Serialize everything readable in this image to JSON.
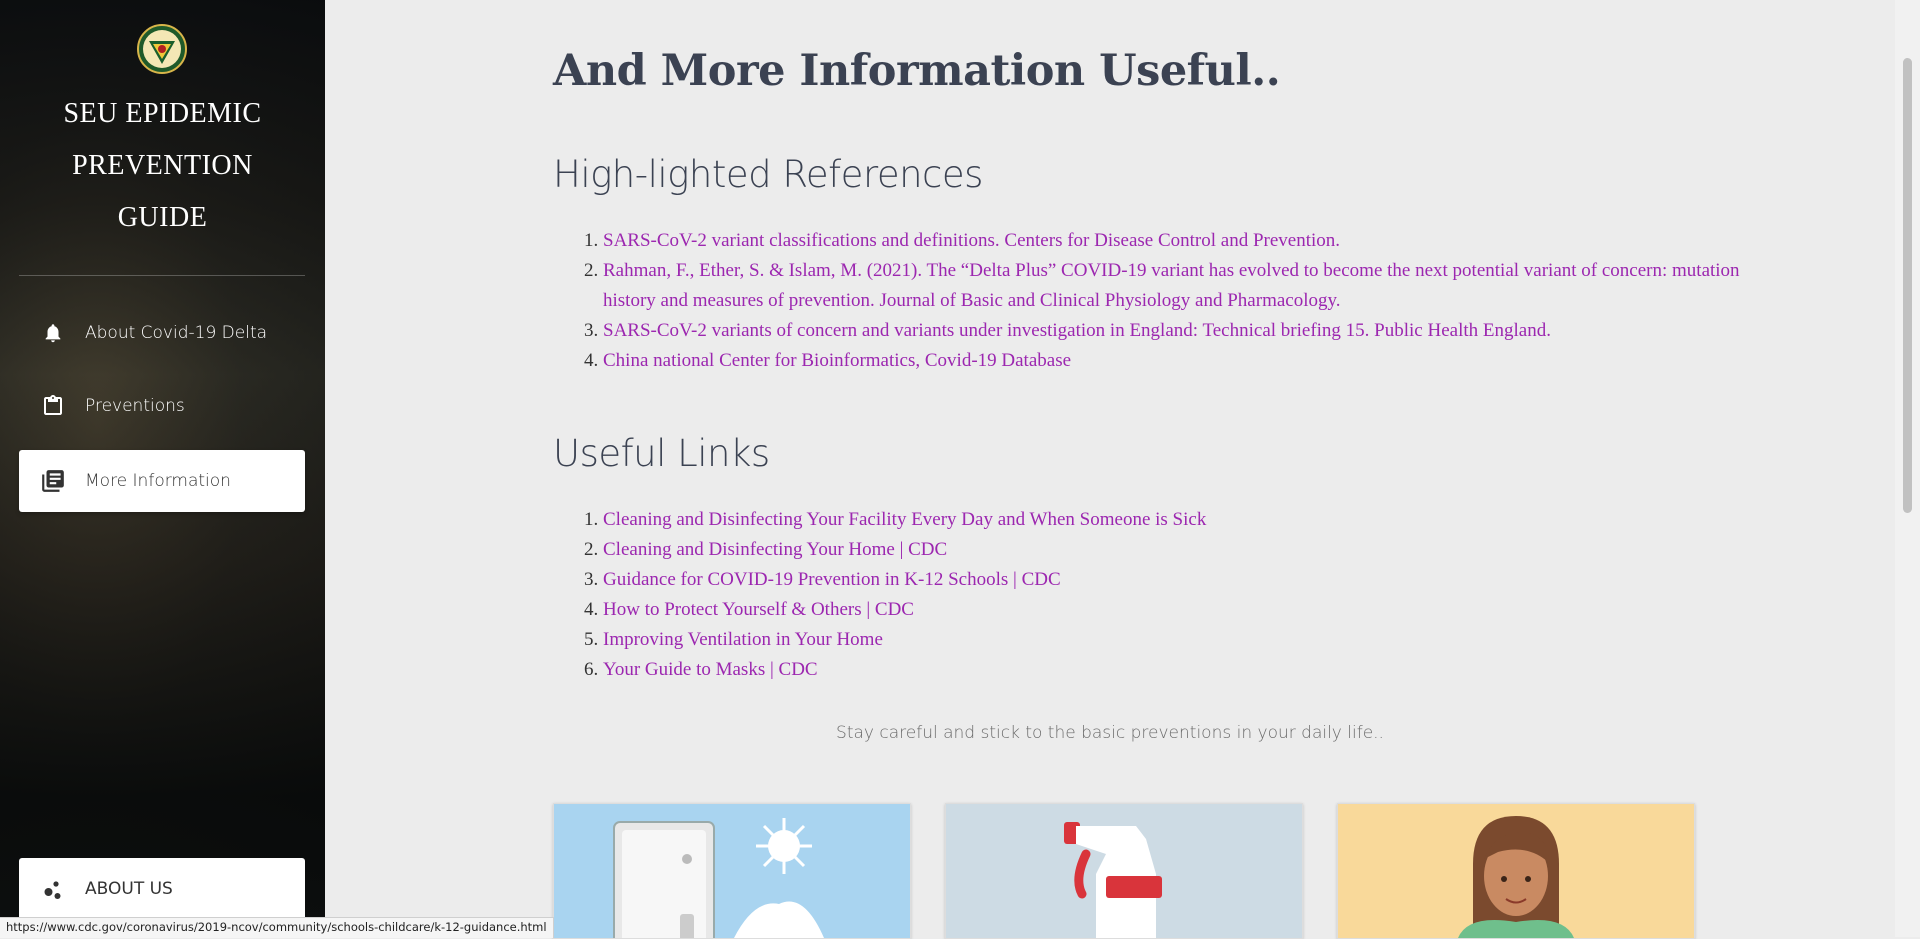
{
  "sidebar": {
    "title_line1": "SEU EPIDEMIC",
    "title_line2": "PREVENTION",
    "title_line3": "GUIDE",
    "nav": [
      {
        "label": "About Covid-19 Delta",
        "icon": "bell-icon"
      },
      {
        "label": "Preventions",
        "icon": "clipboard-icon"
      },
      {
        "label": "More Information",
        "icon": "library-books-icon",
        "active": true
      }
    ],
    "about_label": "ABOUT US"
  },
  "main": {
    "heading": "And More Information Useful..",
    "references_heading": "High-lighted References",
    "references": [
      "SARS-CoV-2 variant classifications and definitions. Centers for Disease Control and Prevention.",
      "Rahman, F., Ether, S. & Islam, M. (2021). The “Delta Plus” COVID-19 variant has evolved to become the next potential variant of concern: mutation history and measures of prevention. Journal of Basic and Clinical Physiology and Pharmacology.",
      "SARS-CoV-2 variants of concern and variants under investigation in England: Technical briefing 15. Public Health England.",
      "China national Center for Bioinformatics, Covid-19 Database"
    ],
    "links_heading": "Useful Links",
    "links": [
      "Cleaning and Disinfecting Your Facility Every Day and When Someone is Sick",
      "Cleaning and Disinfecting Your Home | CDC",
      "Guidance for COVID-19 Prevention in K-12 Schools | CDC",
      "How to Protect Yourself & Others | CDC",
      "Improving Ventilation in Your Home",
      "Your Guide to Masks | CDC"
    ],
    "tagline": "Stay careful and stick to the basic preventions in your daily life..",
    "cards": [
      {
        "icon": "light-switch-illustration",
        "bg": "#a9d4f0"
      },
      {
        "icon": "spray-bottle-illustration",
        "bg": "#cddbe4"
      },
      {
        "icon": "woman-avatar-illustration",
        "bg": "#f9d99a"
      }
    ]
  },
  "status_url": "https://www.cdc.gov/coronavirus/2019-ncov/community/schools-childcare/k-12-guidance.html",
  "colors": {
    "link": "#9c27b0",
    "heading": "#3b4252",
    "background": "#ececec"
  }
}
